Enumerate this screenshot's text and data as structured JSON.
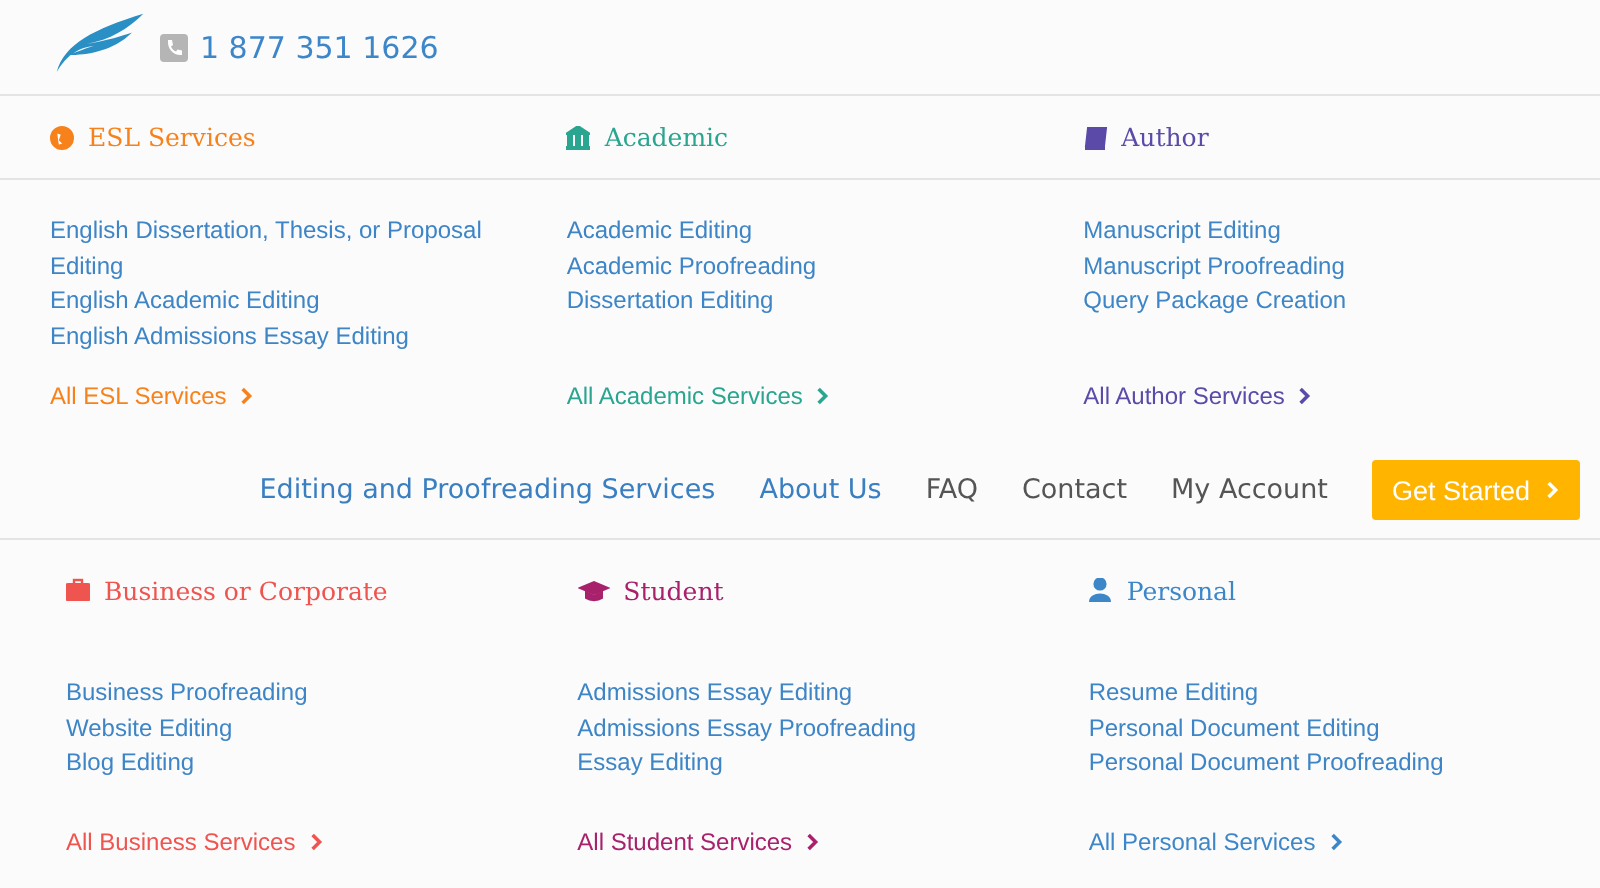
{
  "header": {
    "phone": "1 877 351 1626"
  },
  "menu_top": [
    {
      "title": "ESL Services",
      "color": "#f7821b",
      "links": [
        "English Dissertation, Thesis, or Proposal Editing",
        "English Academic Editing",
        "English Admissions Essay Editing"
      ],
      "all_link": "All ESL Services"
    },
    {
      "title": "Academic",
      "color": "#2aa58f",
      "links": [
        "Academic Editing",
        "Academic Proofreading",
        "Dissertation Editing"
      ],
      "all_link": "All Academic Services"
    },
    {
      "title": "Author",
      "color": "#5b4aa8",
      "links": [
        "Manuscript Editing",
        "Manuscript Proofreading",
        "Query Package Creation"
      ],
      "all_link": "All Author Services"
    }
  ],
  "nav": {
    "items": [
      {
        "label": "Editing and Proofreading Services",
        "selected": true
      },
      {
        "label": "About Us",
        "selected": true
      },
      {
        "label": "FAQ",
        "selected": false
      },
      {
        "label": "Contact",
        "selected": false
      },
      {
        "label": "My Account",
        "selected": false
      }
    ],
    "cta": "Get Started"
  },
  "menu_bottom": [
    {
      "title": "Business or Corporate",
      "color": "#f0544f",
      "links": [
        "Business Proofreading",
        "Website Editing",
        "Blog Editing"
      ],
      "all_link": "All Business Services"
    },
    {
      "title": "Student",
      "color": "#a8216b",
      "links": [
        "Admissions Essay Editing",
        "Admissions Essay Proofreading",
        "Essay Editing"
      ],
      "all_link": "All Student Services"
    },
    {
      "title": "Personal",
      "color": "#3d87c9",
      "links": [
        "Resume Editing",
        "Personal Document Editing",
        "Personal Document Proofreading"
      ],
      "all_link": "All Personal Services"
    }
  ]
}
